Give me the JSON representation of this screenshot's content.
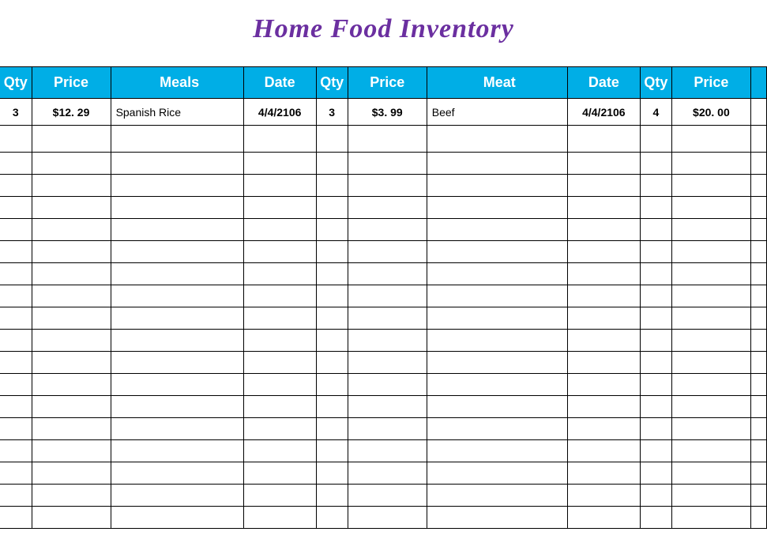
{
  "title": "Home Food Inventory",
  "headers": {
    "qty1": "Qty",
    "price1": "Price",
    "meals": "Meals",
    "date1": "Date",
    "qty2": "Qty",
    "price2": "Price",
    "meat": "Meat",
    "date2": "Date",
    "qty3": "Qty",
    "price3": "Price"
  },
  "row": {
    "qty1": "3",
    "price1": "$12. 29",
    "meals": "Spanish Rice",
    "date1": "4/4/2106",
    "qty2": "3",
    "price2": "$3. 99",
    "meat": "Beef",
    "date2": "4/4/2106",
    "qty3": "4",
    "price3": "$20. 00"
  },
  "empty_rows": 17
}
